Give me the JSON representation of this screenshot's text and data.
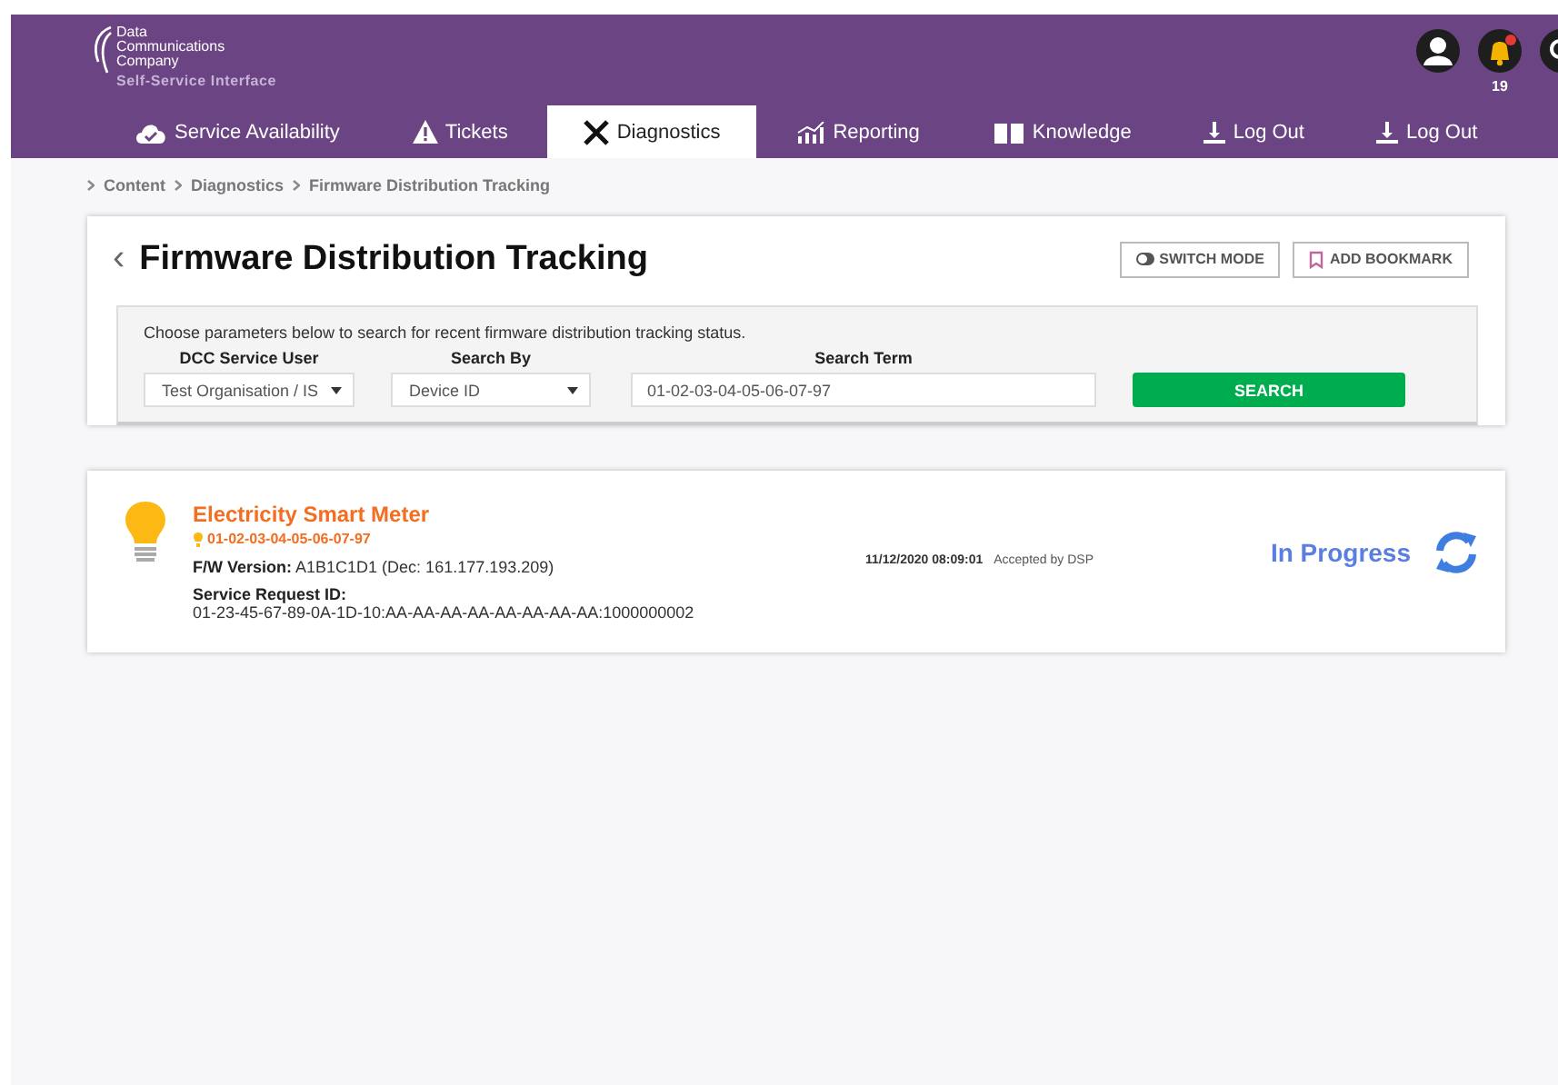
{
  "brand": {
    "name_lines": [
      "Data",
      "Communications",
      "Company"
    ],
    "subtitle": "Self-Service Interface"
  },
  "header_icons": {
    "notification_count": "19"
  },
  "tabs": [
    {
      "label": "Service Availability",
      "selected": false
    },
    {
      "label": "Tickets",
      "selected": false
    },
    {
      "label": "Diagnostics",
      "selected": true
    },
    {
      "label": "Reporting",
      "selected": false
    },
    {
      "label": "Knowledge",
      "selected": false
    },
    {
      "label": "Log Out",
      "selected": false
    },
    {
      "label": "Log Out",
      "selected": false
    }
  ],
  "breadcrumb": [
    "Content",
    "Diagnostics",
    "Firmware Distribution Tracking"
  ],
  "page": {
    "back": "‹",
    "title": "Firmware Distribution Tracking",
    "buttons": [
      {
        "label": "SWITCH MODE"
      },
      {
        "label": "ADD BOOKMARK"
      }
    ]
  },
  "search": {
    "instructions": "Choose parameters below to search for recent firmware distribution tracking status.",
    "fields": [
      {
        "kind": "select",
        "label": "DCC Service User",
        "value": "Test Organisation / IS"
      },
      {
        "kind": "select",
        "label": "Search By",
        "value": "Device ID"
      },
      {
        "kind": "text",
        "label": "Search Term",
        "value": "01-02-03-04-05-06-07-97"
      }
    ],
    "button": "SEARCH"
  },
  "result": {
    "device_type": "Electricity Smart Meter",
    "device_id": "01-02-03-04-05-06-07-97",
    "fw_label": "F/W Version:",
    "fw_value": "A1B1C1D1 (Dec: 161.177.193.209)",
    "sr_label": "Service Request ID:",
    "sr_value": "01-23-45-67-89-0A-1D-10:AA-AA-AA-AA-AA-AA-AA-AA:1000000002",
    "timestamp": "11/12/2020 08:09:01",
    "event": "Accepted by DSP",
    "status": "In Progress"
  }
}
